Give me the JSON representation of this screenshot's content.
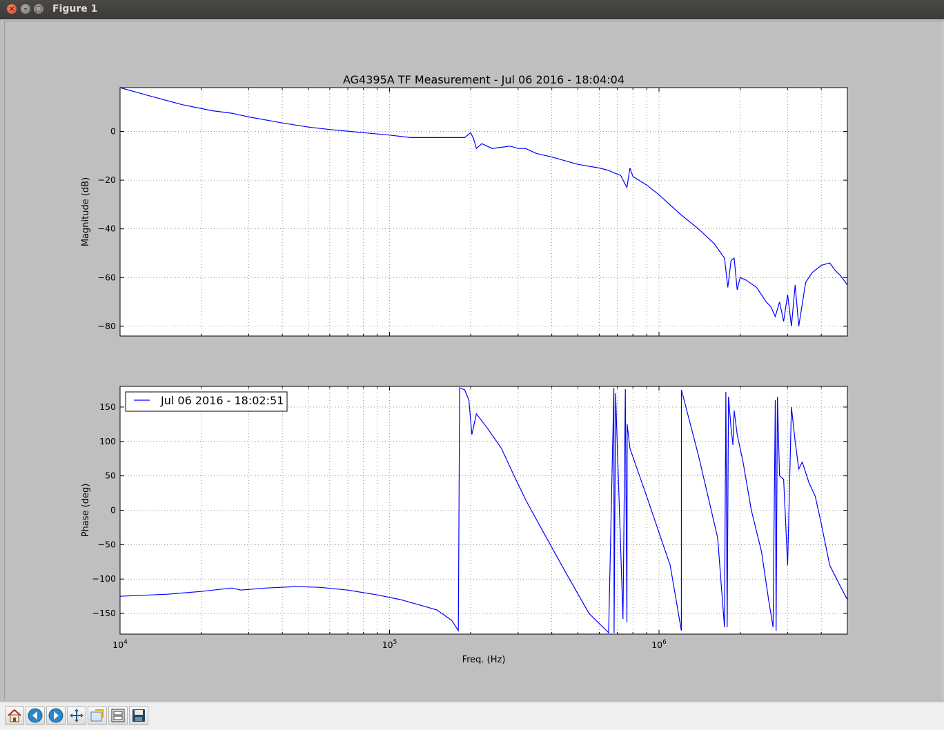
{
  "window": {
    "title": "Figure 1"
  },
  "toolbar": {
    "buttons": [
      {
        "name": "home",
        "icon": "home-icon"
      },
      {
        "name": "back",
        "icon": "back-arrow-icon"
      },
      {
        "name": "forward",
        "icon": "forward-arrow-icon"
      },
      {
        "name": "pan",
        "icon": "pan-icon"
      },
      {
        "name": "zoom",
        "icon": "zoom-rect-icon"
      },
      {
        "name": "subplots",
        "icon": "subplots-icon"
      },
      {
        "name": "save",
        "icon": "save-icon"
      }
    ]
  },
  "chart_data": [
    {
      "type": "line",
      "title": "AG4395A TF Measurement - Jul 06 2016 - 18:04:04",
      "xlabel": "",
      "ylabel": "Magnitude (dB)",
      "xscale": "log",
      "xlim": [
        10000,
        5000000
      ],
      "ylim": [
        -84,
        18
      ],
      "yticks": [
        0,
        -20,
        -40,
        -60,
        -80
      ],
      "grid": true,
      "color": "#0000ff",
      "series": [
        {
          "x": [
            10000,
            13000,
            17000,
            22000,
            26000,
            30000,
            40000,
            50000,
            60000,
            80000,
            100000,
            120000,
            150000,
            170000,
            190000,
            200000,
            205000,
            210000,
            220000,
            240000,
            260000,
            280000,
            300000,
            320000,
            350000,
            400000,
            500000,
            600000,
            650000,
            680000,
            720000,
            760000,
            780000,
            800000,
            900000,
            1000000,
            1200000,
            1400000,
            1600000,
            1750000,
            1800000,
            1850000,
            1900000,
            1950000,
            2000000,
            2100000,
            2300000,
            2500000,
            2600000,
            2700000,
            2800000,
            2900000,
            3000000,
            3100000,
            3200000,
            3300000,
            3500000,
            3700000,
            4000000,
            4300000,
            4500000,
            4700000,
            5000000
          ],
          "y": [
            18,
            14.5,
            11,
            8.5,
            7.5,
            6,
            3.5,
            1.8,
            0.8,
            -0.5,
            -1.5,
            -2.5,
            -2.5,
            -2.5,
            -2.5,
            -0.5,
            -3,
            -7,
            -5,
            -7,
            -6.5,
            -6,
            -7,
            -7,
            -9,
            -10.5,
            -13.5,
            -15,
            -16,
            -17,
            -18,
            -23,
            -15,
            -18.5,
            -22,
            -26,
            -34,
            -40,
            -46,
            -52,
            -64,
            -53,
            -52,
            -65,
            -60,
            -61,
            -64,
            -70,
            -72,
            -76,
            -70,
            -78,
            -67,
            -80,
            -63,
            -80,
            -62,
            -58,
            -55,
            -54,
            -57,
            -59,
            -63
          ]
        }
      ]
    },
    {
      "type": "line",
      "title": "",
      "xlabel": "Freq. (Hz)",
      "ylabel": "Phase (deg)",
      "xscale": "log",
      "xlim": [
        10000,
        5000000
      ],
      "ylim": [
        -180,
        180
      ],
      "yticks": [
        150,
        100,
        50,
        0,
        -50,
        -100,
        -150
      ],
      "xticks": [
        "10^4",
        "10^5",
        "10^6"
      ],
      "grid": true,
      "legend_position": "top-left",
      "color": "#0000ff",
      "series": [
        {
          "name": "Jul 06 2016 - 18:02:51",
          "x": [
            10000,
            15000,
            20000,
            26000,
            28000,
            35000,
            45000,
            55000,
            70000,
            90000,
            110000,
            130000,
            150000,
            170000,
            180000,
            182000,
            190000,
            197000,
            202000,
            210000,
            230000,
            260000,
            290000,
            320000,
            370000,
            450000,
            550000,
            650000,
            680000,
            681000,
            690000,
            735000,
            750000,
            760000,
            762000,
            780000,
            900000,
            1100000,
            1210000,
            1211000,
            1400000,
            1650000,
            1750000,
            1770000,
            1790000,
            1810000,
            1850000,
            1880000,
            1900000,
            1950000,
            2050000,
            2200000,
            2400000,
            2550000,
            2650000,
            2700000,
            2720000,
            2750000,
            2800000,
            2900000,
            3000000,
            3100000,
            3200000,
            3300000,
            3400000,
            3600000,
            3800000,
            4000000,
            4300000,
            4700000,
            5000000
          ],
          "y": [
            -125,
            -122,
            -118,
            -113,
            -116,
            -113,
            -111,
            -112,
            -116,
            -123,
            -130,
            -138,
            -145,
            -160,
            -175,
            178,
            175,
            160,
            110,
            140,
            120,
            90,
            50,
            15,
            -30,
            -90,
            -150,
            -178,
            178,
            -178,
            170,
            -158,
            176,
            -163,
            125,
            90,
            20,
            -80,
            -175,
            175,
            80,
            -40,
            -170,
            172,
            -170,
            165,
            120,
            95,
            145,
            110,
            70,
            0,
            -60,
            -130,
            -170,
            160,
            -175,
            165,
            50,
            45,
            -80,
            150,
            100,
            60,
            70,
            40,
            20,
            -20,
            -80,
            -110,
            -130
          ]
        }
      ]
    }
  ]
}
